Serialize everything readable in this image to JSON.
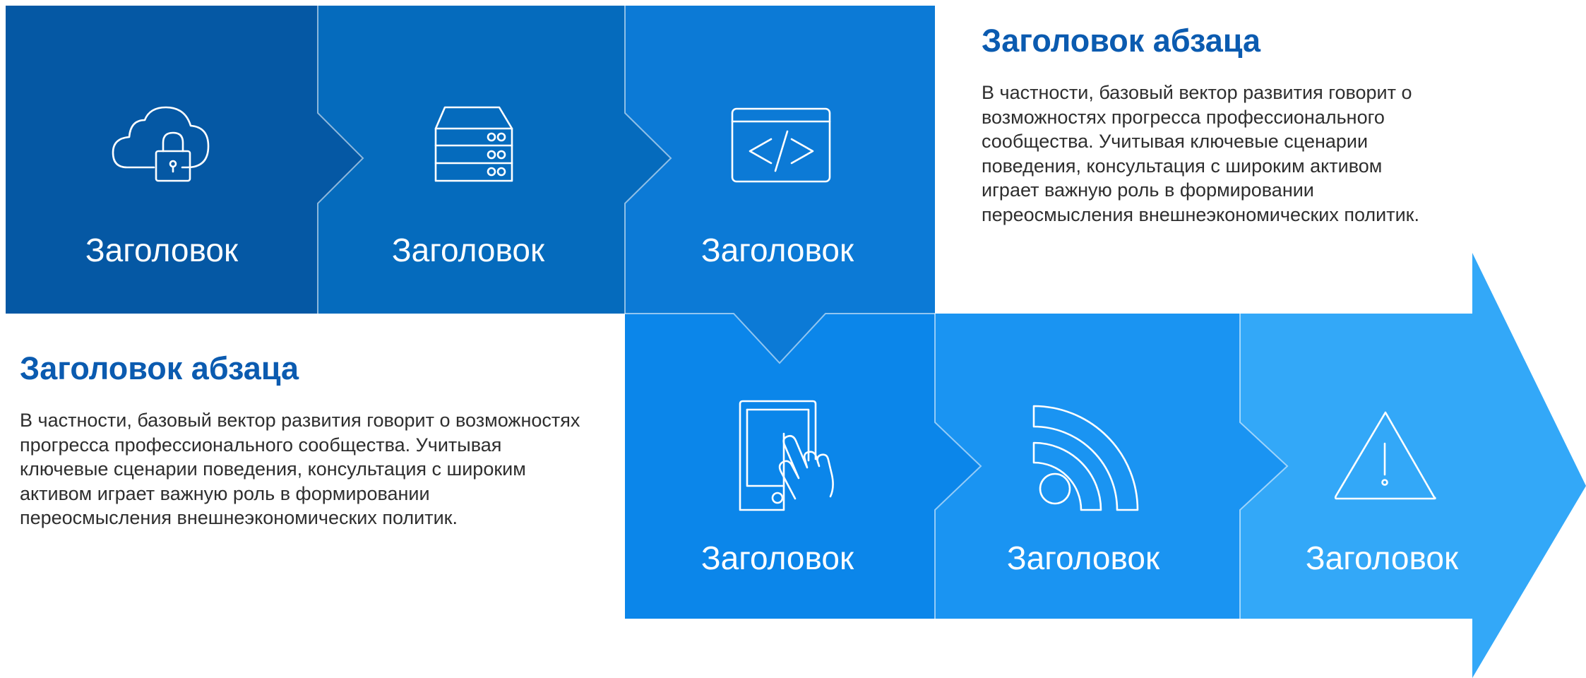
{
  "colors": {
    "tile_1": "#0558a4",
    "tile_2": "#056bbd",
    "tile_3": "#0c7ad6",
    "tile_4": "#0b86ea",
    "tile_5": "#1a94f2",
    "tile_6": "#33a8f8",
    "heading": "#0b5bb0",
    "body_text": "#2e2e2e"
  },
  "steps": [
    {
      "label": "Заголовок",
      "icon": "cloud-lock-icon"
    },
    {
      "label": "Заголовок",
      "icon": "server-stack-icon"
    },
    {
      "label": "Заголовок",
      "icon": "code-window-icon"
    },
    {
      "label": "Заголовок",
      "icon": "tablet-touch-icon"
    },
    {
      "label": "Заголовок",
      "icon": "rss-feed-icon"
    },
    {
      "label": "Заголовок",
      "icon": "warning-triangle-icon"
    }
  ],
  "text_blocks": {
    "top_right": {
      "heading": "Заголовок абзаца",
      "body": "В частности, базовый вектор развития говорит о возможностях прогресса профессионального сообщества. Учитывая ключевые сценарии поведения, консультация с широким активом играет важную роль в формировании переосмысления внешнеэкономических политик."
    },
    "bottom_left": {
      "heading": "Заголовок абзаца",
      "body": "В частности, базовый вектор развития говорит о возможностях прогресса профессионального сообщества. Учитывая ключевые сценарии поведения, консультация с широким активом играет важную роль в формировании переосмысления внешнеэкономических политик."
    }
  }
}
